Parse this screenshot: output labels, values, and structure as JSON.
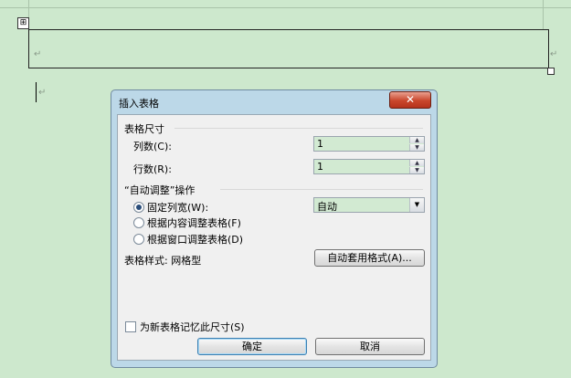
{
  "document": {
    "anchor_icon": "table-move-icon",
    "anchor_glyph": "⊞",
    "paragraph_mark": "↵"
  },
  "dialog": {
    "title": "插入表格",
    "close_glyph": "✕",
    "size_group": "表格尺寸",
    "columns_label": "列数(C):",
    "columns_value": "1",
    "rows_label": "行数(R):",
    "rows_value": "1",
    "autofit_group": "“自动调整”操作",
    "fixed_width_label": "固定列宽(W):",
    "fixed_width_value": "自动",
    "fit_contents_label": "根据内容调整表格(F)",
    "fit_window_label": "根据窗口调整表格(D)",
    "table_style_label": "表格样式: 网格型",
    "autoformat_button": "自动套用格式(A)...",
    "remember_label": "为新表格记忆此尺寸(S)",
    "ok_button": "确定",
    "cancel_button": "取消"
  }
}
